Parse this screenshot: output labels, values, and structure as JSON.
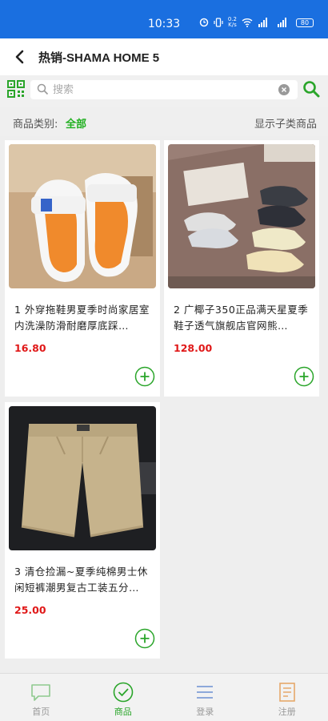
{
  "status_bar": {
    "time": "10:33",
    "net_speed_top": "0.2",
    "net_speed_bottom": "K/s",
    "battery": "80"
  },
  "header": {
    "title": "热销-SHAMA HOME 5"
  },
  "search": {
    "placeholder": "搜索"
  },
  "filter": {
    "label": "商品类别:",
    "value": "全部",
    "toggle": "显示子类商品"
  },
  "products": [
    {
      "name": "1 外穿拖鞋男夏季时尚家居室内洗澡防滑耐磨厚底踩…",
      "price": "16.80",
      "image": "orange-slipper-photo"
    },
    {
      "name": "2 广椰子350正品满天星夏季鞋子透气旗舰店官网熊…",
      "price": "128.00",
      "image": "sneakers-box-photo"
    },
    {
      "name": "3 清仓捡漏~夏季纯棉男士休闲短裤潮男复古工装五分…",
      "price": "25.00",
      "image": "khaki-shorts-photo"
    }
  ],
  "tabbar": [
    {
      "label": "首页",
      "icon": "chat-home-icon"
    },
    {
      "label": "商品",
      "icon": "check-circle-icon"
    },
    {
      "label": "登录",
      "icon": "menu-lines-icon"
    },
    {
      "label": "注册",
      "icon": "document-icon"
    }
  ],
  "colors": {
    "status_bar": "#1a6fe0",
    "accent_green": "#20b020",
    "price_red": "#e01818"
  }
}
